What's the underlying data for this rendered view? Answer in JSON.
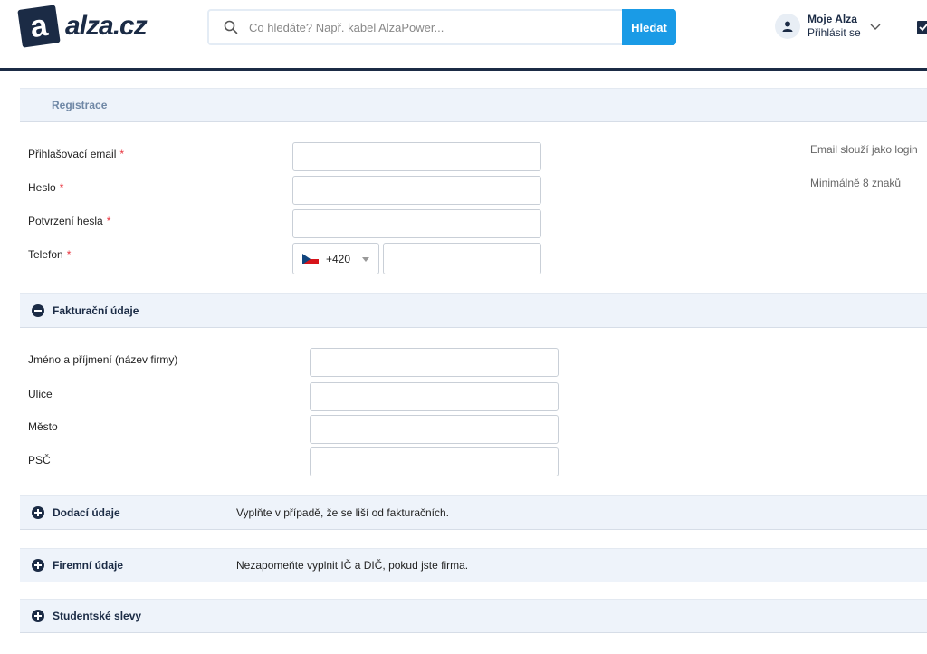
{
  "header": {
    "logo_letter": "a",
    "logo_text": "alza.cz",
    "search_placeholder": "Co hledáte? Např. kabel AlzaPower...",
    "search_button": "Hledat",
    "account_title": "Moje Alza",
    "account_sub": "Přihlásit se"
  },
  "registration": {
    "title": "Registrace",
    "email_label": "Přihlašovací email",
    "password_label": "Heslo",
    "password_confirm_label": "Potvrzení hesla",
    "phone_label": "Telefon",
    "required_mark": "*",
    "email_hint": "Email slouží jako login",
    "password_hint": "Minimálně 8 znaků",
    "phone_prefix": "+420"
  },
  "billing": {
    "title": "Fakturační údaje",
    "name_label": "Jméno a příjmení (název firmy)",
    "street_label": "Ulice",
    "city_label": "Město",
    "zip_label": "PSČ"
  },
  "delivery": {
    "title": "Dodací údaje",
    "note": "Vyplňte v případě, že se liší od fakturačních."
  },
  "company": {
    "title": "Firemní údaje",
    "note": "Nezapomeňte vyplnit IČ a DIČ, pokud jste firma."
  },
  "student": {
    "title": "Studentské slevy"
  },
  "colors": {
    "brand_dark": "#1b2b45",
    "accent_blue": "#1a9be6",
    "required_red": "#e8323c",
    "section_bg": "#eef3fa"
  }
}
